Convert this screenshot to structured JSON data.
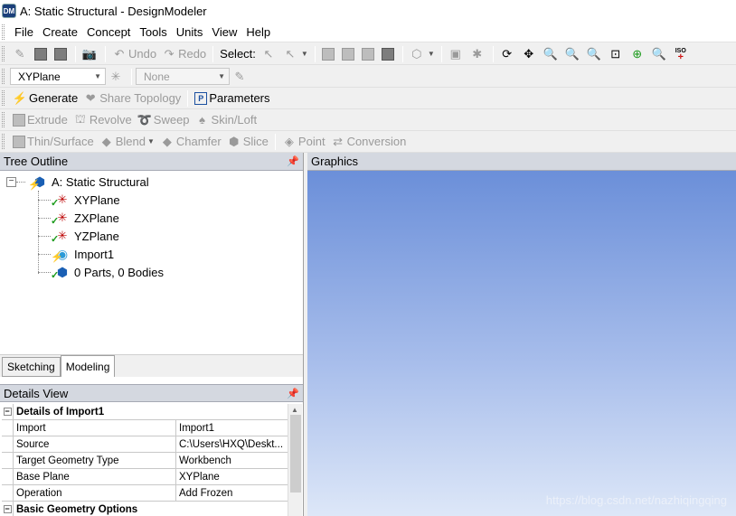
{
  "window": {
    "icon_text": "DM",
    "title": "A: Static Structural - DesignModeler"
  },
  "menu": [
    "File",
    "Create",
    "Concept",
    "Tools",
    "Units",
    "View",
    "Help"
  ],
  "toolbar1": {
    "undo": "Undo",
    "redo": "Redo",
    "select": "Select:",
    "iso": "ISO"
  },
  "toolbar2": {
    "plane": "XYPlane",
    "sketch": "None"
  },
  "toolbar3": {
    "generate": "Generate",
    "share_topology": "Share Topology",
    "parameters": "Parameters"
  },
  "toolbar4": {
    "extrude": "Extrude",
    "revolve": "Revolve",
    "sweep": "Sweep",
    "skin_loft": "Skin/Loft"
  },
  "toolbar5": {
    "thin_surface": "Thin/Surface",
    "blend": "Blend",
    "chamfer": "Chamfer",
    "slice": "Slice",
    "point": "Point",
    "conversion": "Conversion"
  },
  "tree": {
    "header": "Tree Outline",
    "root": "A: Static Structural",
    "items": [
      "XYPlane",
      "ZXPlane",
      "YZPlane",
      "Import1",
      "0 Parts, 0 Bodies"
    ]
  },
  "tabs": [
    "Sketching",
    "Modeling"
  ],
  "details": {
    "header": "Details View",
    "section": "Details of Import1",
    "rows": [
      {
        "name": "Import",
        "value": "Import1"
      },
      {
        "name": "Source",
        "value": "C:\\Users\\HXQ\\Deskt..."
      },
      {
        "name": "Target Geometry Type",
        "value": "Workbench"
      },
      {
        "name": "Base Plane",
        "value": "XYPlane"
      },
      {
        "name": "Operation",
        "value": "Add Frozen"
      }
    ],
    "section2": "Basic Geometry Options"
  },
  "graphics": {
    "header": "Graphics",
    "watermark": "https://blog.csdn.net/nazhiqingqing"
  },
  "colors": {
    "viewport_top": "#6b8fd9",
    "viewport_bottom": "#dde7f8",
    "panel_header": "#d4d8e0"
  }
}
